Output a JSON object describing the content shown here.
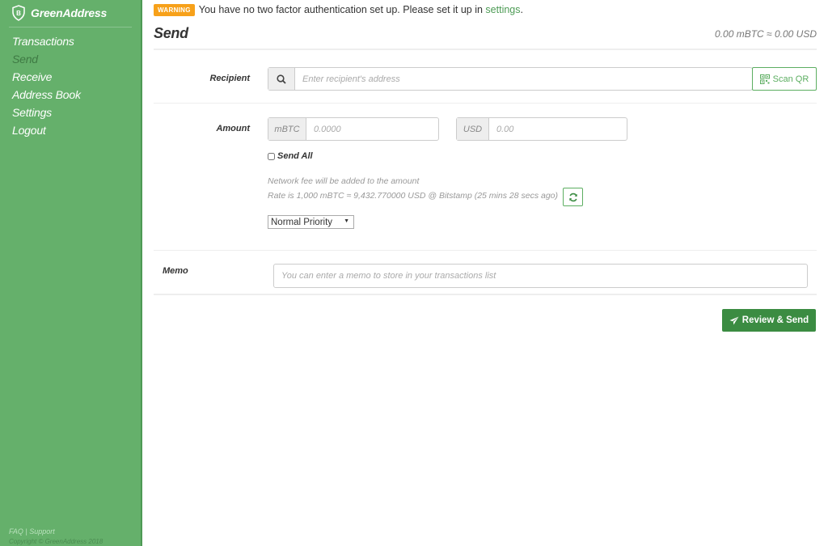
{
  "sidebar": {
    "brand": "GreenAddress",
    "brand_icon": "shield-bitcoin-icon",
    "items": [
      {
        "label": "Transactions",
        "active": false
      },
      {
        "label": "Send",
        "active": true
      },
      {
        "label": "Receive",
        "active": false
      },
      {
        "label": "Address Book",
        "active": false
      },
      {
        "label": "Settings",
        "active": false
      },
      {
        "label": "Logout",
        "active": false
      }
    ],
    "footer": {
      "faq": "FAQ",
      "separator": "|",
      "support": "Support",
      "copyright": "Copyright © GreenAddress 2018"
    }
  },
  "warning": {
    "badge": "WARNING",
    "message": "You have no two factor authentication set up. Please set it up in ",
    "link": "settings",
    "suffix": "."
  },
  "page": {
    "title": "Send",
    "balance": "0.00 mBTC ≈ 0.00 USD"
  },
  "recipient": {
    "label": "Recipient",
    "icon": "search-icon",
    "placeholder": "Enter recipient's address",
    "value": "",
    "scan_qr": "Scan QR"
  },
  "amount": {
    "label": "Amount",
    "btc_unit": "mBTC",
    "btc_placeholder": "0.0000",
    "fiat_unit": "USD",
    "fiat_placeholder": "0.00",
    "send_all": "Send All",
    "send_all_checked": false,
    "fee_note": "Network fee will be added to the amount",
    "rate_note": "Rate is 1,000 mBTC ≈ 9,432.770000 USD @ Bitstamp (25 mins 28 secs ago)",
    "priority": "Normal Priority"
  },
  "memo": {
    "label": "Memo",
    "placeholder": "You can enter a memo to store in your transactions list"
  },
  "actions": {
    "review_send": "Review & Send"
  },
  "colors": {
    "sidebar_bg": "#65b06b",
    "accent": "#5cae61",
    "primary_button": "#3b8c42",
    "warning_badge": "#f7a11a"
  }
}
